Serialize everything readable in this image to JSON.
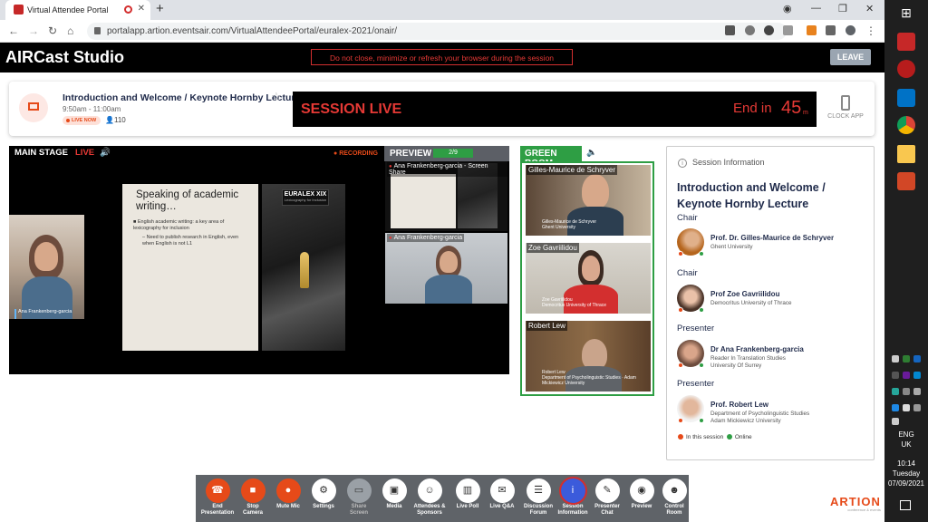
{
  "browser": {
    "tab_title": "Virtual Attendee Portal",
    "url": "portalapp.artion.eventsair.com/VirtualAttendeePortal/euralex-2021/onair/"
  },
  "app": {
    "title": "AIRCast Studio",
    "warning": "Do not close, minimize or refresh your browser during the session",
    "leave_label": "LEAVE"
  },
  "session": {
    "title": "Introduction and Welcome / Keynote Hornby Lecture",
    "time": "9:50am - 11:00am",
    "live_badge": "LIVE NOW",
    "attendees": "110",
    "banner": "SESSION LIVE",
    "end_in_label": "End in",
    "end_in_minutes": "45",
    "end_in_unit": "m",
    "clock_app": "CLOCK APP"
  },
  "stage": {
    "main_label": "MAIN STAGE",
    "live_label": "LIVE",
    "recording_label": "RECORDING",
    "preview_label": "PREVIEW",
    "preview_count": "2/9",
    "feed_name": "Ana Frankenberg-garcia",
    "feed_affil": "Reader In Translation Studies · University Of Surrey",
    "slide": {
      "title": "Speaking of academic writing…",
      "bullet1": "English academic writing: a key area of lexicography for inclusion",
      "bullet2": "Need to publish research in English, even when English is not L1",
      "logo": "EURALEX XIX",
      "logo_sub": "Lexicography for Inclusion"
    },
    "preview_tiles": [
      {
        "label": "Ana Frankenberg-garcia - Screen Share"
      },
      {
        "label": "Ana Frankenberg-garcia"
      }
    ]
  },
  "green_room": {
    "label": "GREEN ROOM",
    "tiles": [
      {
        "name": "Gilles-Maurice de Schryver",
        "tag": "Gilles-Maurice de Schryver",
        "tag_affil": "Ghent University"
      },
      {
        "name": "Zoe Gavriilidou",
        "tag": "Zoe Gavriilidou",
        "tag_affil": "Democritus University of Thrace"
      },
      {
        "name": "Robert Lew",
        "tag": "Robert Lew",
        "tag_affil": "Department of Psycholinguistic Studies · Adam Mickiewicz University"
      }
    ]
  },
  "session_info": {
    "header": "Session Information",
    "title": "Introduction and Welcome / Keynote Hornby Lecture",
    "people": [
      {
        "role": "Chair",
        "name": "Prof. Dr. Gilles-Maurice de Schryver",
        "affil1": "Ghent University",
        "affil2": ""
      },
      {
        "role": "Chair",
        "name": "Prof Zoe Gavriilidou",
        "affil1": "Democritus University of Thrace",
        "affil2": ""
      },
      {
        "role": "Presenter",
        "name": "Dr Ana Frankenberg-garcia",
        "affil1": "Reader In Translation Studies",
        "affil2": "University Of Surrey"
      },
      {
        "role": "Presenter",
        "name": "Prof. Robert Lew",
        "affil1": "Department of Psycholinguistic Studies",
        "affil2": "Adam Mickiewicz University"
      }
    ],
    "legend_in_session": "In this session",
    "legend_online": "Online"
  },
  "toolbar": [
    {
      "l1": "End",
      "l2": "Presentation",
      "icon": "phone-hangup-icon",
      "glyph": "☎"
    },
    {
      "l1": "Stop",
      "l2": "Camera",
      "icon": "camera-icon",
      "glyph": "■"
    },
    {
      "l1": "Mute Mic",
      "l2": "",
      "icon": "mic-icon",
      "glyph": "●"
    },
    {
      "l1": "Settings",
      "l2": "",
      "icon": "gear-icon",
      "glyph": "⚙"
    },
    {
      "l1": "Share",
      "l2": "Screen",
      "icon": "share-screen-icon",
      "glyph": "▭"
    },
    {
      "l1": "Media",
      "l2": "",
      "icon": "media-icon",
      "glyph": "▣"
    },
    {
      "l1": "Attendees &",
      "l2": "Sponsors",
      "icon": "people-icon",
      "glyph": "☺"
    },
    {
      "l1": "Live Poll",
      "l2": "",
      "icon": "poll-icon",
      "glyph": "▥"
    },
    {
      "l1": "Live Q&A",
      "l2": "",
      "icon": "qa-icon",
      "glyph": "✉"
    },
    {
      "l1": "Discussion",
      "l2": "Forum",
      "icon": "forum-icon",
      "glyph": "☰"
    },
    {
      "l1": "Session",
      "l2": "Information",
      "icon": "info-icon",
      "glyph": "i"
    },
    {
      "l1": "Presenter",
      "l2": "Chat",
      "icon": "chat-icon",
      "glyph": "✎"
    },
    {
      "l1": "Preview",
      "l2": "",
      "icon": "eye-icon",
      "glyph": "◉"
    },
    {
      "l1": "Control",
      "l2": "Room",
      "icon": "user-icon",
      "glyph": "☻"
    }
  ],
  "brand": {
    "name": "ARTION",
    "tagline": "conference & events"
  },
  "taskbar": {
    "lang1": "ENG",
    "lang2": "UK",
    "time": "10:14",
    "day": "Tuesday",
    "date": "07/09/2021"
  },
  "colors": {
    "accent": "#e64a19",
    "green": "#2e9e44",
    "navy": "#1f2a4a"
  }
}
